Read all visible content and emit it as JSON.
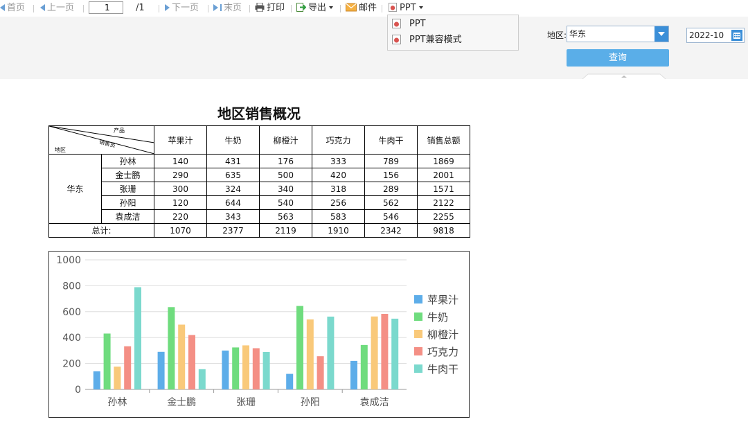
{
  "toolbar": {
    "first": "首页",
    "prev": "上一页",
    "page_value": "1",
    "page_total": "/1",
    "next": "下一页",
    "last": "末页",
    "print": "打印",
    "export": "导出",
    "mail": "邮件",
    "ppt": "PPT"
  },
  "ppt_menu": {
    "items": [
      "PPT",
      "PPT兼容模式"
    ]
  },
  "filters": {
    "region_label": "地区:",
    "region_value": "华东",
    "date_value": "2022-10",
    "query_label": "查询"
  },
  "report": {
    "title": "地区销售概况",
    "corner": {
      "product": "产品",
      "salesperson": "销售员",
      "region": "地区"
    },
    "columns": [
      "苹果汁",
      "牛奶",
      "柳橙汁",
      "巧克力",
      "牛肉干",
      "销售总额"
    ],
    "region": "华东",
    "rows": [
      {
        "name": "孙林",
        "values": [
          "140",
          "431",
          "176",
          "333",
          "789",
          "1869"
        ]
      },
      {
        "name": "金士鹏",
        "values": [
          "290",
          "635",
          "500",
          "420",
          "156",
          "2001"
        ]
      },
      {
        "name": "张珊",
        "values": [
          "300",
          "324",
          "340",
          "318",
          "289",
          "1571"
        ]
      },
      {
        "name": "孙阳",
        "values": [
          "120",
          "644",
          "540",
          "256",
          "562",
          "2122"
        ]
      },
      {
        "name": "袁成洁",
        "values": [
          "220",
          "343",
          "563",
          "583",
          "546",
          "2255"
        ]
      }
    ],
    "total_label": "总计:",
    "totals": [
      "1070",
      "2377",
      "2119",
      "1910",
      "2342",
      "9818"
    ]
  },
  "chart_data": {
    "type": "bar",
    "categories": [
      "孙林",
      "金士鹏",
      "张珊",
      "孙阳",
      "袁成洁"
    ],
    "series": [
      {
        "name": "苹果汁",
        "color": "#5dade9",
        "values": [
          140,
          290,
          300,
          120,
          220
        ]
      },
      {
        "name": "牛奶",
        "color": "#6fdc7e",
        "values": [
          431,
          635,
          324,
          644,
          343
        ]
      },
      {
        "name": "柳橙汁",
        "color": "#f9c97a",
        "values": [
          176,
          500,
          340,
          540,
          563
        ]
      },
      {
        "name": "巧克力",
        "color": "#f48f85",
        "values": [
          333,
          420,
          318,
          256,
          583
        ]
      },
      {
        "name": "牛肉干",
        "color": "#7bd9cd",
        "values": [
          789,
          156,
          289,
          562,
          546
        ]
      }
    ],
    "ylim": [
      0,
      1000
    ],
    "yticks": [
      "0",
      "200",
      "400",
      "600",
      "800",
      "1000"
    ],
    "grid": true,
    "legend": "right"
  }
}
